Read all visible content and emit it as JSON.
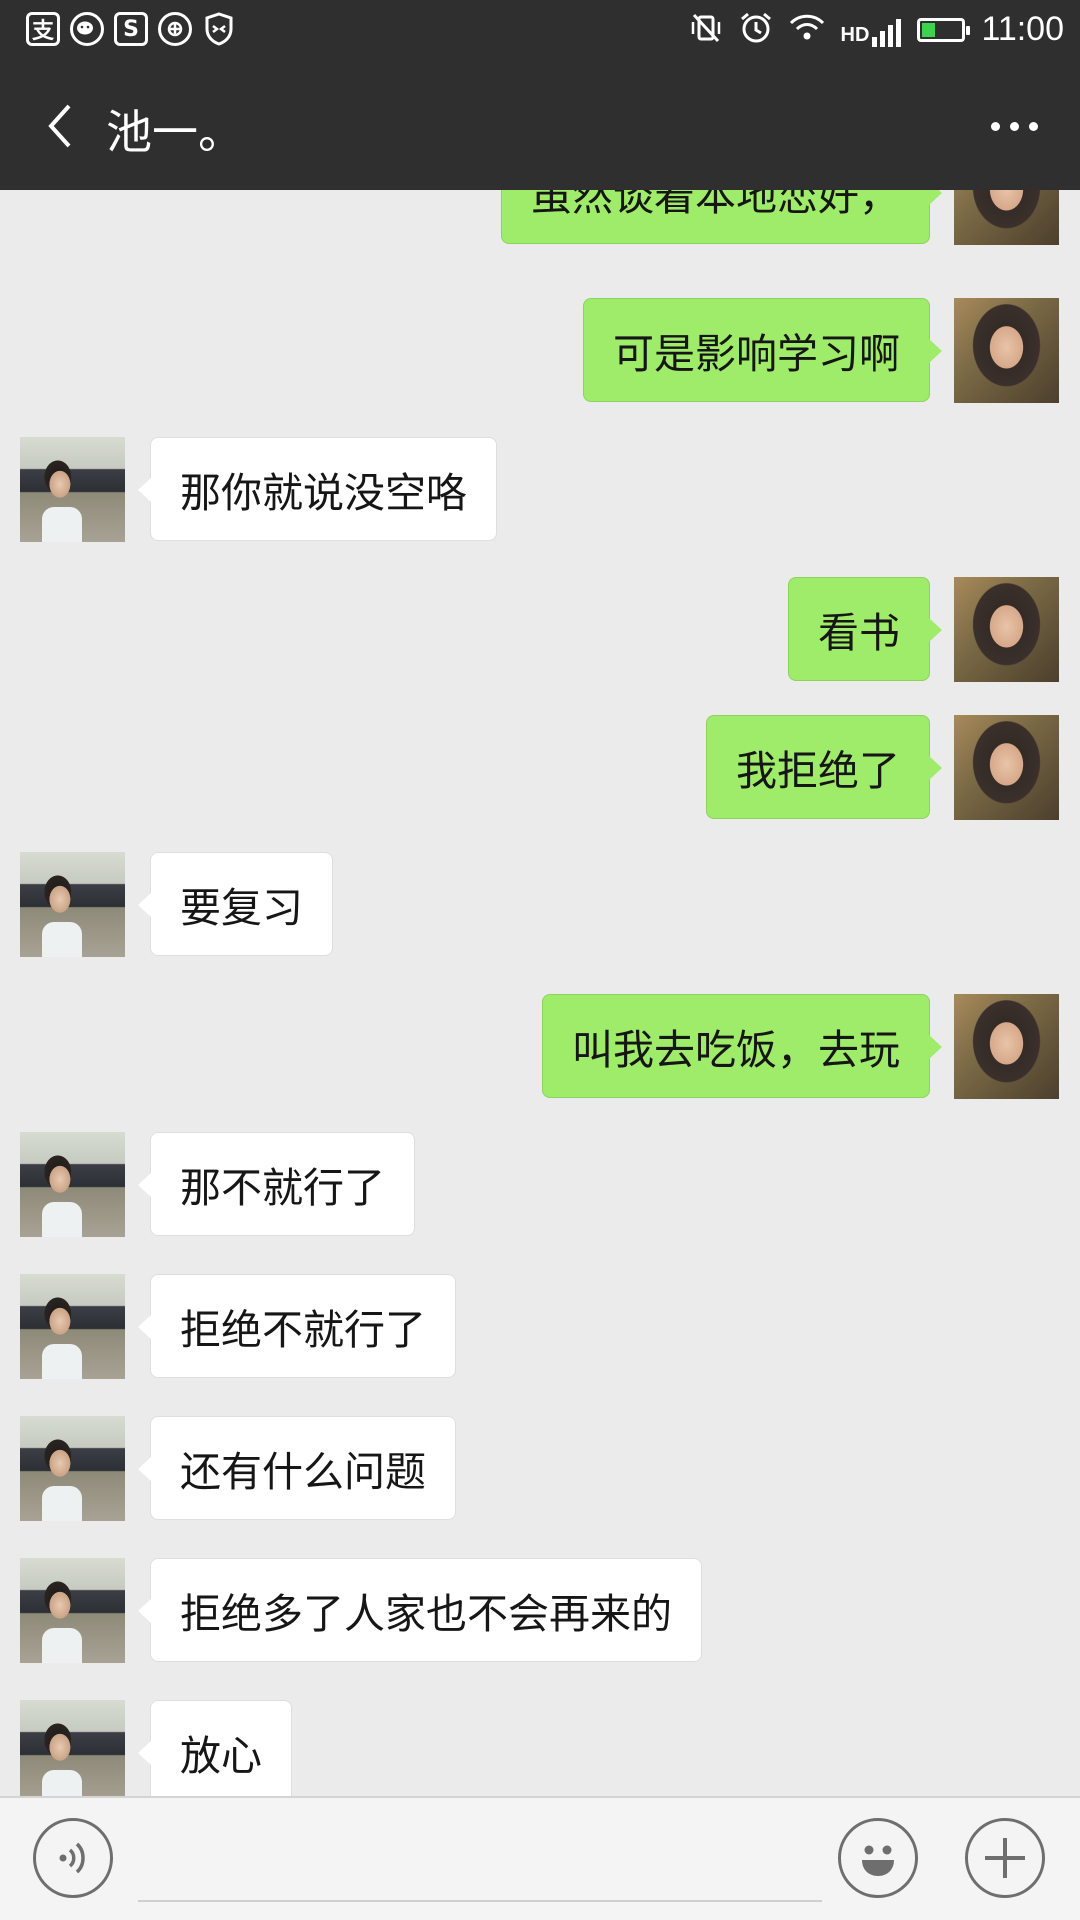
{
  "status_bar": {
    "left_icons": [
      "alipay-icon",
      "wechat-icon",
      "music-app-icon",
      "sync-app-icon",
      "shield-app-icon"
    ],
    "left_glyphs": [
      "支",
      "",
      "S",
      "",
      ""
    ],
    "right_icons": [
      "vibrate-icon",
      "alarm-icon",
      "wifi-icon",
      "hd-signal-icon",
      "battery-icon"
    ],
    "hd_label": "HD",
    "battery_level": 0.3,
    "battery_color": "#3fd24f",
    "time": "11:00"
  },
  "header": {
    "title": "池一。",
    "back_icon": "chevron-left-icon",
    "more_icon": "more-dots-icon"
  },
  "colors": {
    "sent_bubble": "#9feb6a",
    "received_bubble": "#ffffff",
    "chat_background": "#ebebeb",
    "header_background": "#2f2f2f"
  },
  "messages": [
    {
      "side": "me",
      "text": "虽然谈着本地恋好，"
    },
    {
      "side": "me",
      "text": "可是影响学习啊"
    },
    {
      "side": "other",
      "text": "那你就说没空咯"
    },
    {
      "side": "me",
      "text": "看书"
    },
    {
      "side": "me",
      "text": "我拒绝了"
    },
    {
      "side": "other",
      "text": "要复习"
    },
    {
      "side": "me",
      "text": "叫我去吃饭，去玩"
    },
    {
      "side": "other",
      "text": "那不就行了"
    },
    {
      "side": "other",
      "text": "拒绝不就行了"
    },
    {
      "side": "other",
      "text": "还有什么问题"
    },
    {
      "side": "other",
      "text": "拒绝多了人家也不会再来的"
    },
    {
      "side": "other",
      "text": "放心"
    }
  ],
  "input_bar": {
    "placeholder": "",
    "voice_icon": "voice-icon",
    "emoji_icon": "emoji-icon",
    "plus_icon": "plus-icon"
  }
}
